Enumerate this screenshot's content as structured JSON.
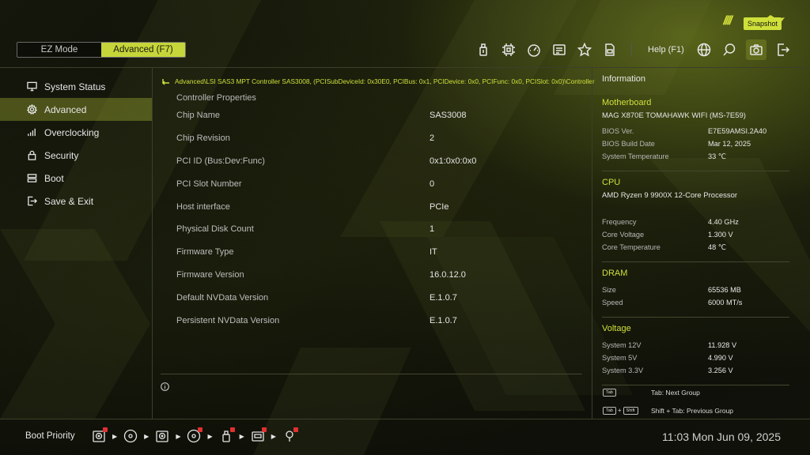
{
  "modes": {
    "ez": "EZ Mode",
    "advanced": "Advanced (F7)"
  },
  "toolbar": {
    "help_label": "Help (F1)",
    "snapshot_tooltip": "Snapshot",
    "icons": [
      "usb-flash-icon",
      "cpu-icon",
      "speedometer-icon",
      "board-explorer-icon",
      "favorite-star-icon",
      "hardware-monitor-icon",
      "language-globe-icon",
      "search-icon",
      "snapshot-camera-icon",
      "exit-icon"
    ]
  },
  "sidebar": {
    "items": [
      {
        "label": "System Status",
        "icon": "monitor-icon"
      },
      {
        "label": "Advanced",
        "icon": "gear-icon"
      },
      {
        "label": "Overclocking",
        "icon": "bar-chart-icon"
      },
      {
        "label": "Security",
        "icon": "lock-icon"
      },
      {
        "label": "Boot",
        "icon": "boot-icon"
      },
      {
        "label": "Save & Exit",
        "icon": "exit-icon"
      }
    ],
    "active_index": 1
  },
  "main": {
    "breadcrumb": "Advanced\\LSI SAS3 MPT Controller SAS3008, (PCISubDeviceId: 0x30E0, PCIBus: 0x1, PCIDevice: 0x0, PCIFunc: 0x0, PCISlot: 0x0)\\Controller",
    "section_title": "Controller Properties",
    "properties": [
      {
        "name": "Chip Name",
        "value": "SAS3008"
      },
      {
        "name": "Chip Revision",
        "value": "2"
      },
      {
        "name": "PCI ID (Bus:Dev:Func)",
        "value": "0x1:0x0:0x0"
      },
      {
        "name": "PCI Slot Number",
        "value": "0"
      },
      {
        "name": "Host interface",
        "value": "PCIe"
      },
      {
        "name": "Physical Disk Count",
        "value": "1"
      },
      {
        "name": "Firmware Type",
        "value": "IT"
      },
      {
        "name": "Firmware Version",
        "value": "16.0.12.0"
      },
      {
        "name": "Default NVData Version",
        "value": "E.1.0.7"
      },
      {
        "name": "Persistent NVData Version",
        "value": "E.1.0.7"
      }
    ]
  },
  "info": {
    "title": "Information",
    "motherboard": {
      "title": "Motherboard",
      "model": "MAG X870E TOMAHAWK WIFI (MS-7E59)",
      "rows": [
        {
          "k": "BIOS Ver.",
          "v": "E7E59AMSI.2A40"
        },
        {
          "k": "BIOS Build Date",
          "v": "Mar 12, 2025"
        },
        {
          "k": "System Temperature",
          "v": "33 ℃"
        }
      ]
    },
    "cpu": {
      "title": "CPU",
      "model": "AMD Ryzen 9 9900X 12-Core Processor",
      "rows": [
        {
          "k": "Frequency",
          "v": "4.40 GHz"
        },
        {
          "k": "Core Voltage",
          "v": "1.300 V"
        },
        {
          "k": "Core Temperature",
          "v": "48 ℃"
        }
      ]
    },
    "dram": {
      "title": "DRAM",
      "rows": [
        {
          "k": "Size",
          "v": "65536 MB"
        },
        {
          "k": "Speed",
          "v": "6000 MT/s"
        }
      ]
    },
    "voltage": {
      "title": "Voltage",
      "rows": [
        {
          "k": "System 12V",
          "v": "11.928 V"
        },
        {
          "k": "System 5V",
          "v": "4.990 V"
        },
        {
          "k": "System 3.3V",
          "v": "3.256 V"
        }
      ]
    }
  },
  "keyhelp": [
    {
      "keys": "Tab",
      "text": "Tab: Next Group"
    },
    {
      "keys": "Tab + Shift",
      "text": "Shift + Tab: Previous Group"
    }
  ],
  "keycaps": {
    "tab": "Tab",
    "shift": "Shift",
    "plus": "+"
  },
  "bottom": {
    "boot_priority_label": "Boot Priority",
    "boot_devices": [
      "hdd-icon",
      "optical-disc-icon",
      "hdd-icon",
      "optical-disc-icon",
      "usb-icon",
      "usb-drive-icon",
      "usb-icon"
    ],
    "clock": "11:03  Mon Jun 09, 2025"
  },
  "colors": {
    "accent": "#cfe03a",
    "active_bg": "#6b7324",
    "background": "#0c0d08"
  }
}
